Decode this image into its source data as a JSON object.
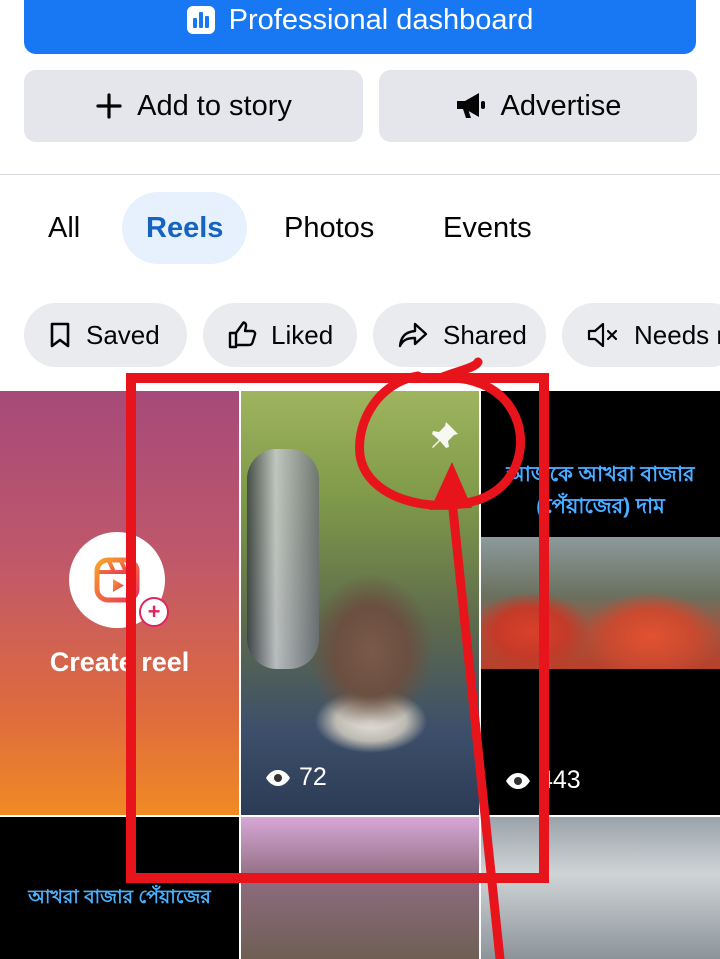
{
  "header": {
    "professional_dashboard_label": "Professional dashboard",
    "add_to_story_label": "Add to story",
    "advertise_label": "Advertise"
  },
  "tabs": [
    {
      "label": "All",
      "active": false
    },
    {
      "label": "Reels",
      "active": true
    },
    {
      "label": "Photos",
      "active": false
    },
    {
      "label": "Events",
      "active": false
    }
  ],
  "filters": [
    {
      "label": "Saved",
      "icon": "bookmark-icon"
    },
    {
      "label": "Liked",
      "icon": "thumbs-up-icon"
    },
    {
      "label": "Shared",
      "icon": "share-icon"
    },
    {
      "label": "Needs r",
      "icon": "muted-speaker-icon"
    }
  ],
  "grid": {
    "create_reel_label": "Create reel",
    "tiles": [
      {
        "views": "72",
        "pinned": true
      },
      {
        "title": "আজকে আখরা বাজার (পেঁয়াজের) দাম",
        "views": "443"
      },
      {
        "title": "আখরা বাজার পেঁয়াজের"
      }
    ]
  },
  "colors": {
    "brand_blue": "#1877f2",
    "annotation_red": "#e8141c"
  }
}
